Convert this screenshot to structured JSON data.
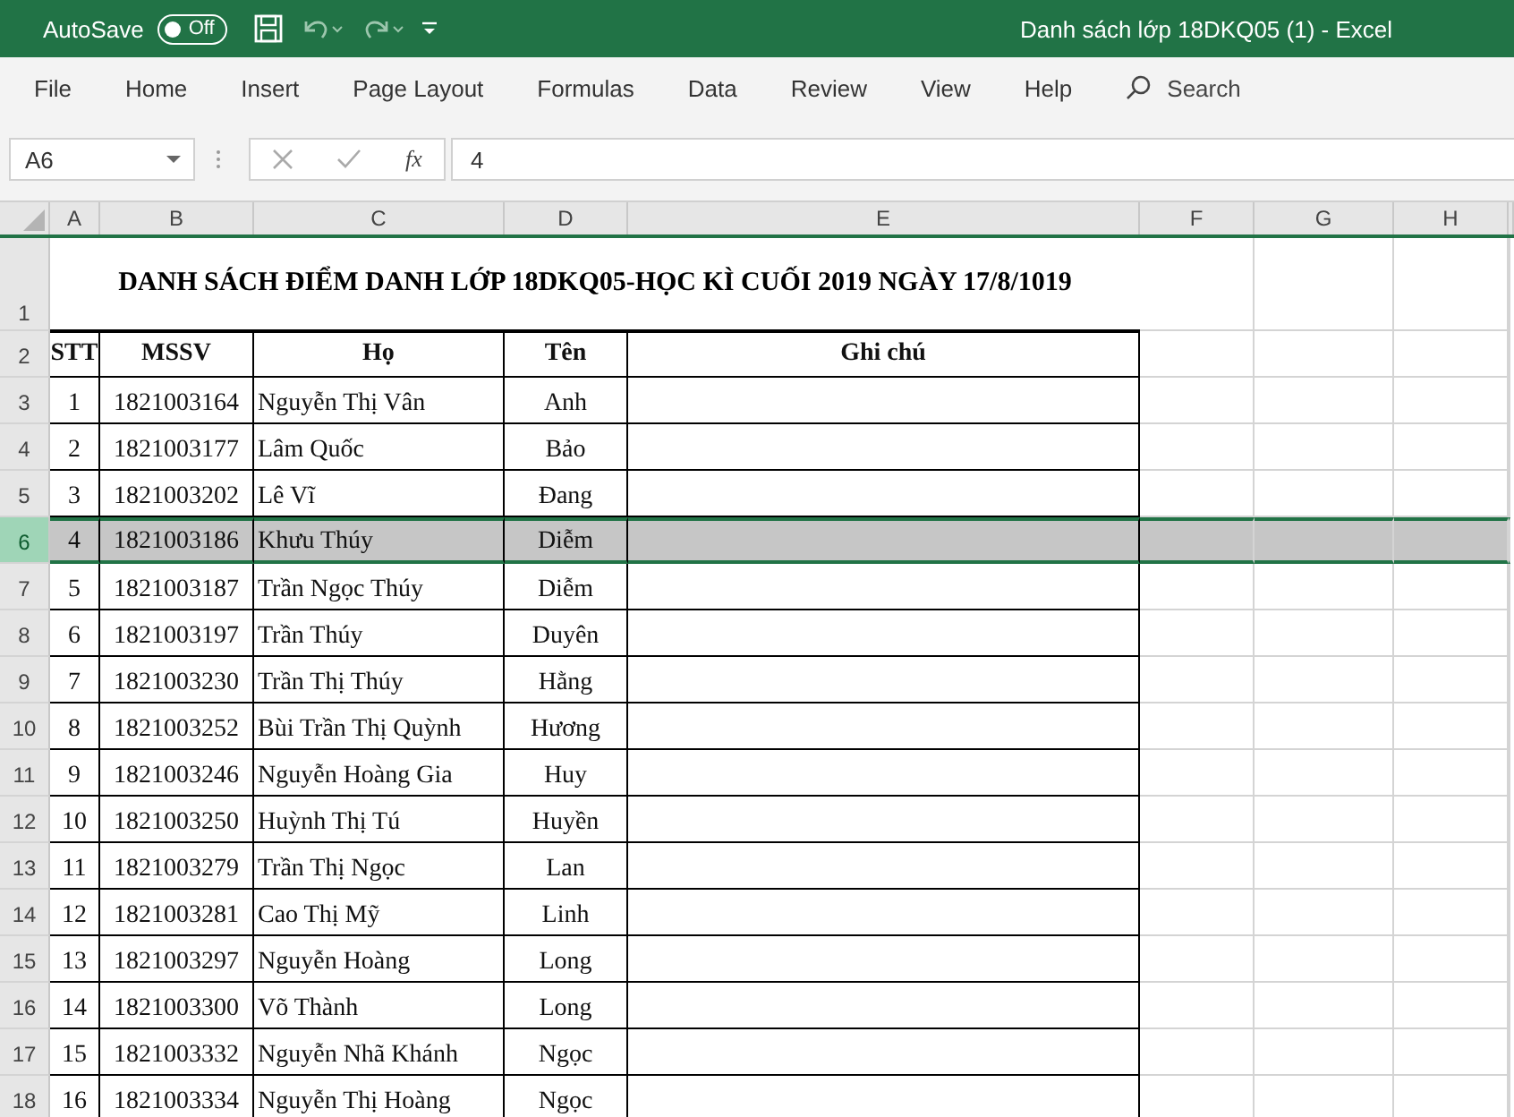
{
  "title_bar": {
    "autosave_label": "AutoSave",
    "autosave": {
      "on": false,
      "label": "Off"
    },
    "title": "Danh sách lớp 18DKQ05 (1)  -  Excel"
  },
  "menu": [
    "File",
    "Home",
    "Insert",
    "Page Layout",
    "Formulas",
    "Data",
    "Review",
    "View",
    "Help"
  ],
  "search": {
    "placeholder": "Search"
  },
  "formula_bar": {
    "name_box": "A6",
    "fx_label": "fx",
    "formula": "4"
  },
  "sheet": {
    "columns": [
      "A",
      "B",
      "C",
      "D",
      "E",
      "F",
      "G",
      "H"
    ],
    "title_row": {
      "row": "1",
      "text": "DANH SÁCH ĐIỂM DANH LỚP 18DKQ05-HỌC KÌ CUỐI 2019 NGÀY 17/8/1019"
    },
    "header_row": {
      "row": "2",
      "cells": [
        "STT",
        "MSSV",
        "Họ",
        "Tên",
        "Ghi chú"
      ]
    },
    "rows": [
      {
        "row": "3",
        "stt": "1",
        "mssv": "1821003164",
        "ho": "Nguyễn Thị Vân",
        "ten": "Anh",
        "selected": false
      },
      {
        "row": "4",
        "stt": "2",
        "mssv": "1821003177",
        "ho": "Lâm Quốc",
        "ten": "Bảo",
        "selected": false
      },
      {
        "row": "5",
        "stt": "3",
        "mssv": "1821003202",
        "ho": "Lê Vĩ",
        "ten": "Đang",
        "selected": false
      },
      {
        "row": "6",
        "stt": "4",
        "mssv": "1821003186",
        "ho": "Khưu Thúy",
        "ten": "Diễm",
        "selected": true
      },
      {
        "row": "7",
        "stt": "5",
        "mssv": "1821003187",
        "ho": "Trần Ngọc Thúy",
        "ten": "Diễm",
        "selected": false
      },
      {
        "row": "8",
        "stt": "6",
        "mssv": "1821003197",
        "ho": "Trần Thúy",
        "ten": "Duyên",
        "selected": false
      },
      {
        "row": "9",
        "stt": "7",
        "mssv": "1821003230",
        "ho": "Trần Thị Thúy",
        "ten": "Hằng",
        "selected": false
      },
      {
        "row": "10",
        "stt": "8",
        "mssv": "1821003252",
        "ho": "Bùi Trần Thị Quỳnh",
        "ten": "Hương",
        "selected": false
      },
      {
        "row": "11",
        "stt": "9",
        "mssv": "1821003246",
        "ho": "Nguyễn Hoàng Gia",
        "ten": "Huy",
        "selected": false
      },
      {
        "row": "12",
        "stt": "10",
        "mssv": "1821003250",
        "ho": "Huỳnh Thị Tú",
        "ten": "Huyền",
        "selected": false
      },
      {
        "row": "13",
        "stt": "11",
        "mssv": "1821003279",
        "ho": "Trần Thị Ngọc",
        "ten": "Lan",
        "selected": false
      },
      {
        "row": "14",
        "stt": "12",
        "mssv": "1821003281",
        "ho": "Cao Thị Mỹ",
        "ten": "Linh",
        "selected": false
      },
      {
        "row": "15",
        "stt": "13",
        "mssv": "1821003297",
        "ho": "Nguyễn Hoàng",
        "ten": "Long",
        "selected": false
      },
      {
        "row": "16",
        "stt": "14",
        "mssv": "1821003300",
        "ho": "Võ Thành",
        "ten": "Long",
        "selected": false
      },
      {
        "row": "17",
        "stt": "15",
        "mssv": "1821003332",
        "ho": "Nguyễn Nhã Khánh",
        "ten": "Ngọc",
        "selected": false
      },
      {
        "row": "18",
        "stt": "16",
        "mssv": "1821003334",
        "ho": "Nguyễn Thị Hoàng",
        "ten": "Ngọc",
        "selected": false
      }
    ]
  }
}
